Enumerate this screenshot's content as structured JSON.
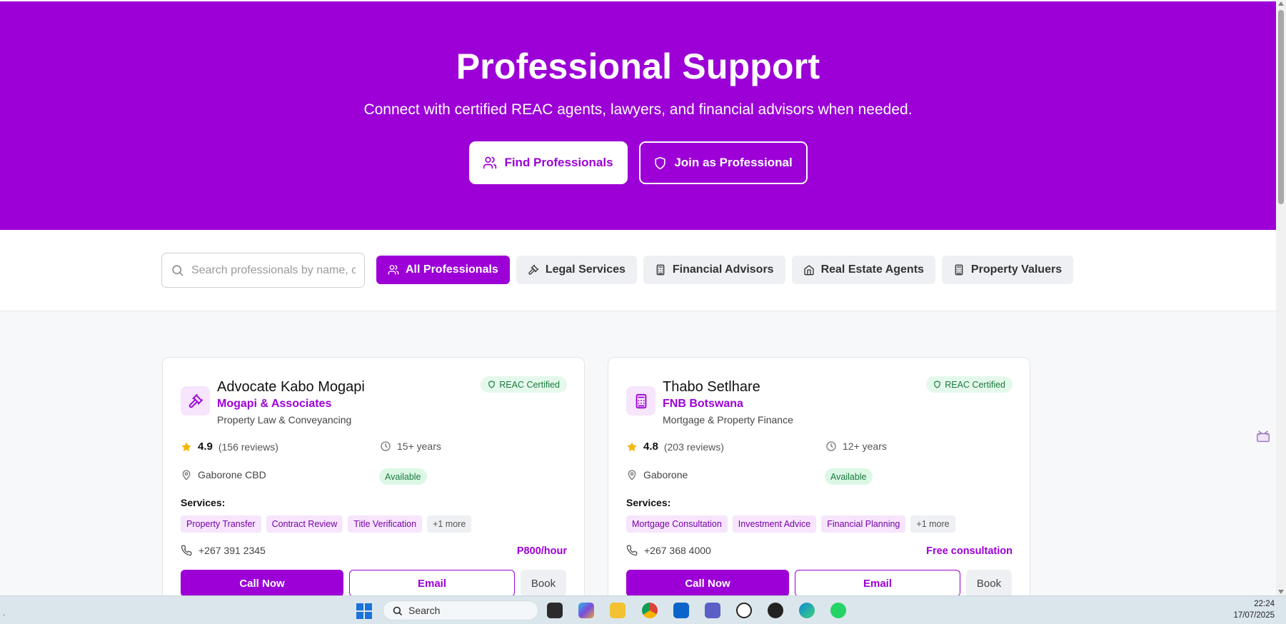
{
  "hero": {
    "title": "Professional Support",
    "subtitle": "Connect with certified REAC agents, lawyers, and financial advisors when needed.",
    "find_label": "Find Professionals",
    "join_label": "Join as Professional"
  },
  "filters": {
    "search_placeholder": "Search professionals by name, company, or specialty...",
    "chips": [
      "All Professionals",
      "Legal Services",
      "Financial Advisors",
      "Real Estate Agents",
      "Property Valuers"
    ],
    "active_chip": "All Professionals"
  },
  "cards": [
    {
      "name": "Advocate Kabo Mogapi",
      "firm": "Mogapi & Associates",
      "specialty": "Property Law & Conveyancing",
      "badge": "REAC Certified",
      "rating": "4.9",
      "reviews": "(156 reviews)",
      "experience": "15+ years",
      "location": "Gaborone CBD",
      "availability": "Available",
      "services_label": "Services:",
      "services": [
        "Property Transfer",
        "Contract Review",
        "Title Verification"
      ],
      "more": "+1 more",
      "phone": "+267 391 2345",
      "price": "P800/hour",
      "call_label": "Call Now",
      "email_label": "Email",
      "book_label": "Book",
      "icon": "gavel-icon"
    },
    {
      "name": "Thabo Setlhare",
      "firm": "FNB Botswana",
      "specialty": "Mortgage & Property Finance",
      "badge": "REAC Certified",
      "rating": "4.8",
      "reviews": "(203 reviews)",
      "experience": "12+ years",
      "location": "Gaborone",
      "availability": "Available",
      "services_label": "Services:",
      "services": [
        "Mortgage Consultation",
        "Investment Advice",
        "Financial Planning"
      ],
      "more": "+1 more",
      "phone": "+267 368 4000",
      "price": "Free consultation",
      "call_label": "Call Now",
      "email_label": "Email",
      "book_label": "Book",
      "icon": "calculator-icon"
    }
  ],
  "taskbar": {
    "search_label": "Search",
    "time": "22:24",
    "date": "17/07/2025"
  },
  "colors": {
    "brand": "#9c00d6",
    "success": "#1a7a3c",
    "star": "#f5b400"
  }
}
